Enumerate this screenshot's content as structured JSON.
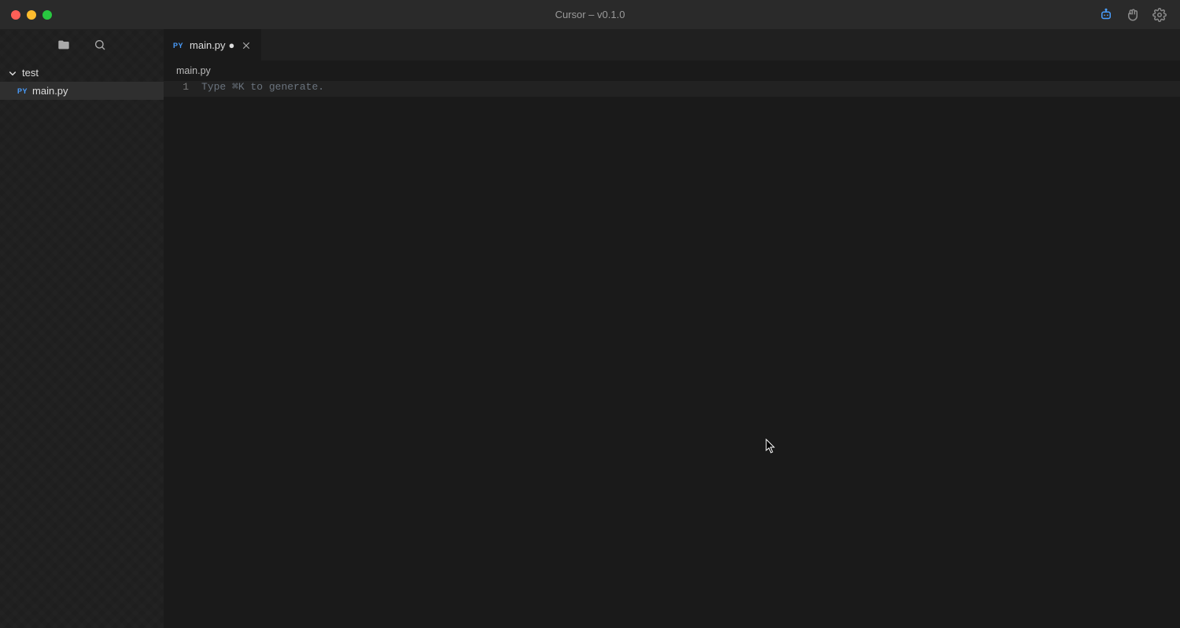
{
  "titlebar": {
    "title": "Cursor – v0.1.0"
  },
  "sidebar": {
    "folder": {
      "name": "test"
    },
    "files": [
      {
        "badge": "PY",
        "name": "main.py"
      }
    ]
  },
  "tabs": [
    {
      "badge": "PY",
      "label": "main.py",
      "dirty": "●"
    }
  ],
  "breadcrumb": {
    "path": "main.py"
  },
  "editor": {
    "lines": [
      {
        "num": "1",
        "text": "Type ⌘K to generate."
      }
    ]
  }
}
